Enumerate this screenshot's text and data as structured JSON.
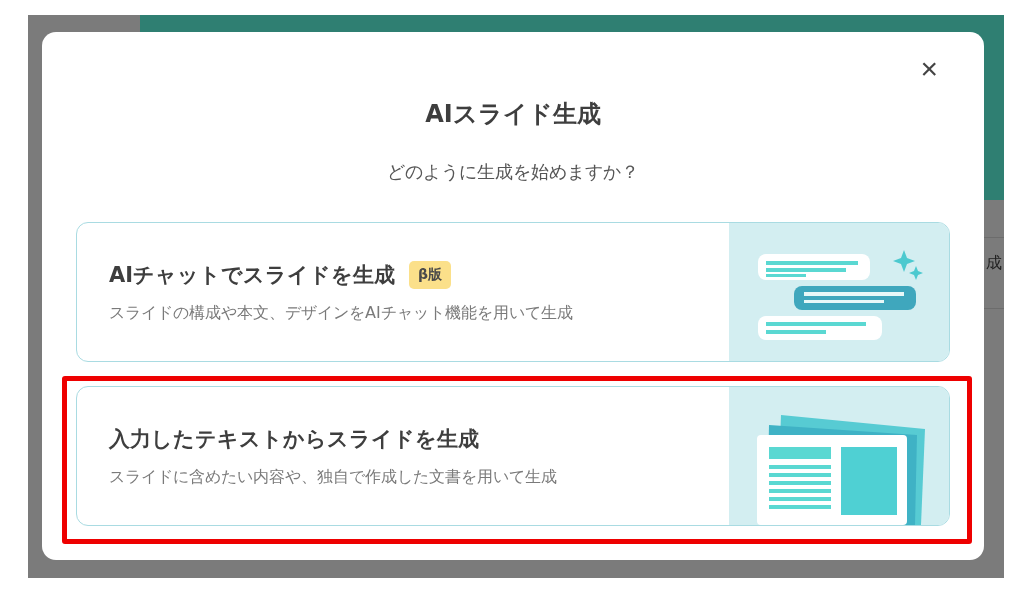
{
  "background": {
    "side_text": "成"
  },
  "modal": {
    "close": "×",
    "title": "AIスライド生成",
    "subtitle": "どのように生成を始めますか？",
    "options": [
      {
        "kind": "chat",
        "title": "AIチャットでスライドを生成",
        "badge": "β版",
        "description": "スライドの構成や本文、デザインをAIチャット機能を用いて生成",
        "highlighted": false
      },
      {
        "kind": "document",
        "title": "入力したテキストからスライドを生成",
        "description": "スライドに含めたい内容や、独自で作成した文書を用いて生成",
        "highlighted": true
      }
    ]
  }
}
